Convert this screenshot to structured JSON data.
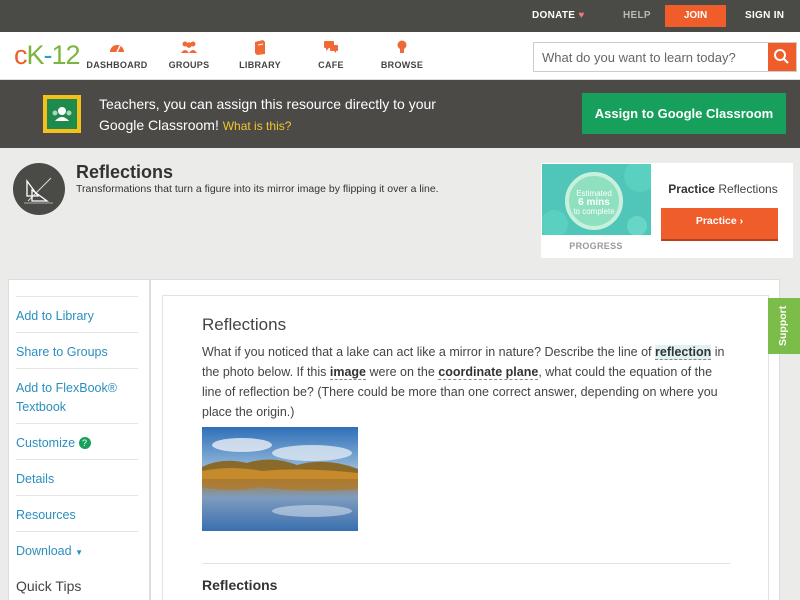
{
  "topbar": {
    "donate": "DONATE",
    "help": "HELP",
    "join": "JOIN",
    "signin": "SIGN IN"
  },
  "header": {
    "logo": {
      "c": "c",
      "k": "K",
      "dash": "-",
      "num": "12"
    },
    "nav": [
      {
        "label": "DASHBOARD",
        "icon": "speedometer-icon"
      },
      {
        "label": "GROUPS",
        "icon": "people-icon"
      },
      {
        "label": "LIBRARY",
        "icon": "book-icon"
      },
      {
        "label": "CAFE",
        "icon": "chat-bubbles-icon"
      },
      {
        "label": "BROWSE",
        "icon": "lightbulb-icon"
      }
    ],
    "search_placeholder": "What do you want to learn today?"
  },
  "banner": {
    "text": "Teachers, you can assign this resource directly to your Google Classroom!",
    "what_link": "What is this?",
    "assign_button": "Assign to Google Classroom"
  },
  "concept": {
    "title": "Reflections",
    "subtitle": "Transformations that turn a figure into its mirror image by flipping it over a line."
  },
  "practice": {
    "estimated": "Estimated",
    "mins": "6 mins",
    "to_complete": "to complete",
    "progress_label": "PROGRESS",
    "title_bold": "Practice",
    "title_rest": "Reflections",
    "button": "Practice"
  },
  "sidebar": {
    "items": [
      {
        "label": "Add to Library"
      },
      {
        "label": "Share to Groups"
      },
      {
        "label": "Add to FlexBook® Textbook"
      },
      {
        "label": "Customize"
      },
      {
        "label": "Details"
      },
      {
        "label": "Resources"
      },
      {
        "label": "Download"
      }
    ],
    "quick_tips": "Quick Tips"
  },
  "content": {
    "title": "Reflections",
    "p1": "What if you noticed that a lake can act like a mirror in nature? Describe the line of ",
    "kw1": "reflection",
    "p2": " in the photo below. If this ",
    "kw2": "image",
    "p3": " were on the ",
    "kw3": "coordinate plane",
    "p4": ", what could the equation of the line of reflection be? (There could be more than one correct answer, depending on where you place the origin.)",
    "subheading": "Reflections"
  },
  "support": "Support",
  "colors": {
    "brand_orange": "#ef5d2b",
    "brand_green": "#17a05b",
    "link_blue": "#2a8fbd",
    "support_green": "#7cbd4a"
  }
}
